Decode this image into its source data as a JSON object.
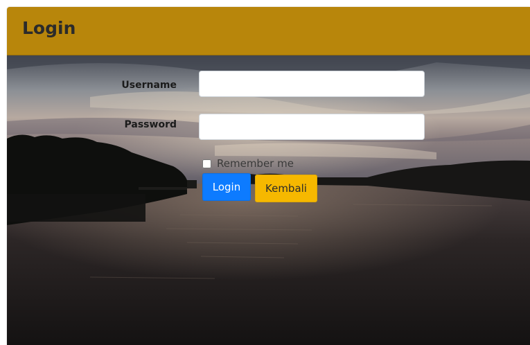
{
  "header": {
    "title": "Login",
    "color": "#b8860b"
  },
  "form": {
    "username_label": "Username",
    "username_value": "",
    "password_label": "Password",
    "password_value": "",
    "remember_label": "Remember me",
    "remember_checked": false,
    "login_button": "Login",
    "back_button": "Kembali"
  },
  "colors": {
    "login_button": "#0d7bff",
    "back_button": "#f6b800"
  },
  "background": {
    "description_icon": "lake-sunset-photo"
  }
}
